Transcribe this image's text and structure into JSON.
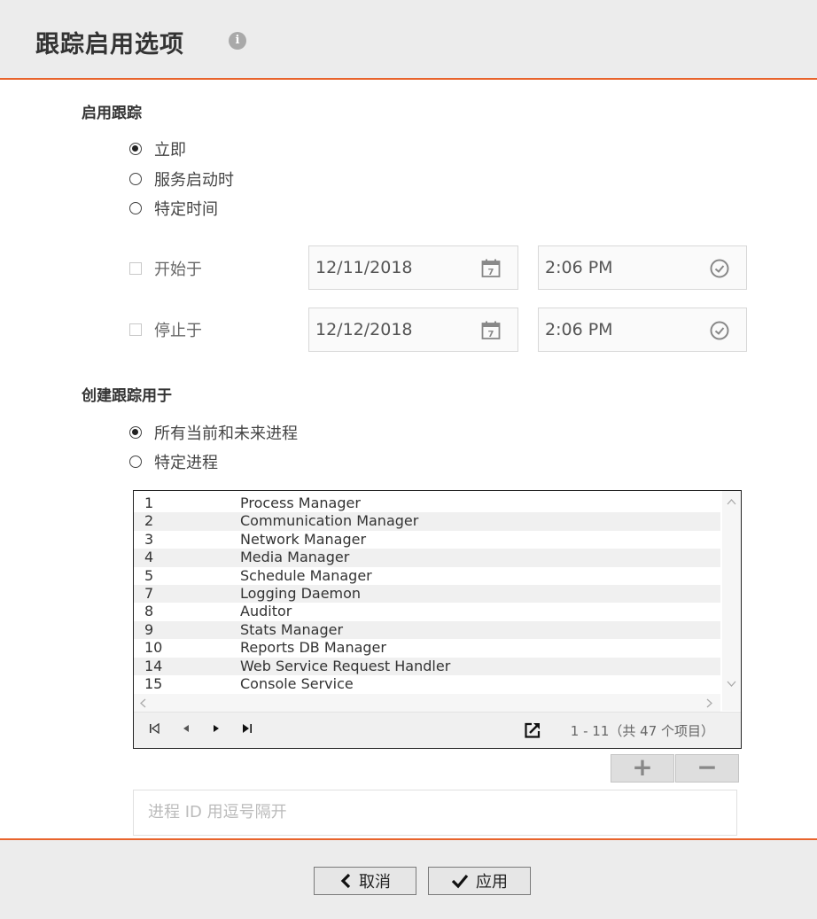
{
  "header": {
    "title": "跟踪启用选项",
    "info_icon": "info-icon"
  },
  "enable_section": {
    "title": "启用跟踪",
    "options": [
      "立即",
      "服务启动时",
      "特定时间"
    ],
    "selected": "立即",
    "start": {
      "label": "开始于",
      "checked": false,
      "date": "12/11/2018",
      "time": "2:06 PM"
    },
    "stop": {
      "label": "停止于",
      "checked": false,
      "date": "12/12/2018",
      "time": "2:06 PM"
    }
  },
  "create_section": {
    "title": "创建跟踪用于",
    "options": [
      "所有当前和未来进程",
      "特定进程"
    ],
    "selected": "所有当前和未来进程"
  },
  "process_list": {
    "rows": [
      {
        "id": "1",
        "name": "Process Manager"
      },
      {
        "id": "2",
        "name": "Communication Manager"
      },
      {
        "id": "3",
        "name": "Network Manager"
      },
      {
        "id": "4",
        "name": "Media Manager"
      },
      {
        "id": "5",
        "name": "Schedule Manager"
      },
      {
        "id": "7",
        "name": "Logging Daemon"
      },
      {
        "id": "8",
        "name": "Auditor"
      },
      {
        "id": "9",
        "name": "Stats Manager"
      },
      {
        "id": "10",
        "name": "Reports DB Manager"
      },
      {
        "id": "14",
        "name": "Web Service Request Handler"
      },
      {
        "id": "15",
        "name": "Console Service"
      }
    ],
    "pager_info": "1 - 11（共 47 个项目）"
  },
  "add_label": "+",
  "remove_label": "−",
  "pid_input": {
    "placeholder": "进程 ID 用逗号隔开"
  },
  "footer": {
    "cancel_label": "取消",
    "apply_label": "应用"
  },
  "colors": {
    "accent": "#e8642c",
    "header_bg": "#ececec"
  }
}
